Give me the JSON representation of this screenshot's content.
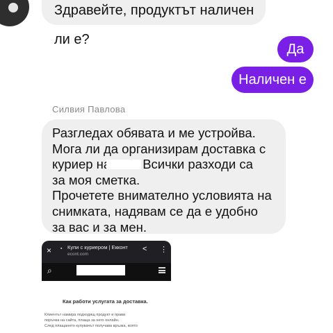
{
  "messages": {
    "first_incoming": "Здравейте, продуктът наличен ли е?",
    "reply_1": "Да",
    "reply_2": "Наличен е",
    "sender_name": "Силвия Павлова",
    "long_message": {
      "line_1": "Разгледах обявата и ме устройва.",
      "line_2": "Мога ли да организирам доставка с",
      "line_3_before": "куриер на",
      "line_3_after": "Всички разходи са",
      "line_4": "за моя сметка.",
      "line_5": "Прочетете внимателно условията на",
      "line_6": "снимката, надявам се да е удобно",
      "line_7": "за вас и за мен."
    }
  },
  "attachment": {
    "page_title": "Купи с куриером | Екконт",
    "url": "econt.com",
    "heading": "Как работи услугата за доставка.",
    "body_lines": [
      "Клиентът намира подходящ продукт и прави",
      "поръчка на сайта, плаща за него онлайн.",
      "След плащането купувачът получава връзка, която"
    ]
  },
  "icons": {
    "close": "×",
    "lock": "🔒",
    "share": "<",
    "menu": "⋮",
    "search": "⌕"
  },
  "colors": {
    "outgoing_bubble": "#7a1fe6",
    "incoming_bubble": "#efefef"
  }
}
